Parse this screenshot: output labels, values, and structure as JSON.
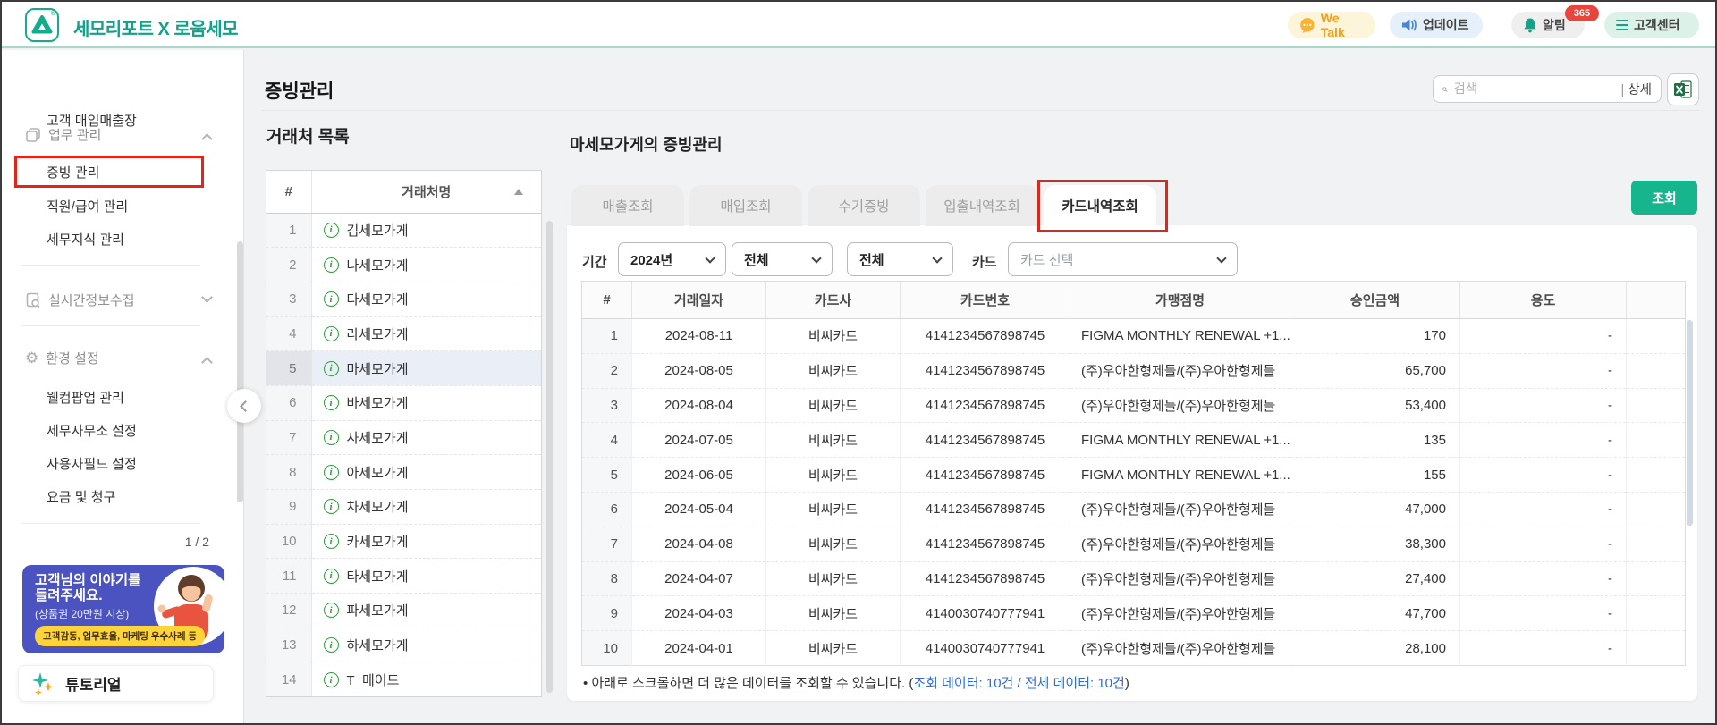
{
  "colors": {
    "accent_teal": "#12a188",
    "button_green": "#17b58e",
    "annotation_red": "#e0261b",
    "alarm_badge_red": "#e8453c",
    "link_blue": "#2f6be0",
    "banner_blue": "#4b53c0",
    "banner_yellow": "#ffd43a"
  },
  "header": {
    "brand": "세모리포트 X 로움세모",
    "we_talk": "We Talk",
    "update": "업데이트",
    "alarm": "알림",
    "alarm_badge": "365",
    "support": "고객센터"
  },
  "sidebar": {
    "customer_ledger": "고객 매입매출장",
    "work_section": "업무 관리",
    "work_items": [
      "증빙 관리",
      "직원/급여 관리",
      "세무지식 관리"
    ],
    "realtime_section": "실시간정보수집",
    "settings_section": "환경 설정",
    "settings_items": [
      "웰컴팝업 관리",
      "세무사무소 설정",
      "사용자필드 설정",
      "요금 및 청구"
    ],
    "banner_pager": "1 / 2",
    "banner": {
      "line1": "고객님의 이야기를",
      "line2": "들려주세요.",
      "line3": "(상품권 20만원 시상)",
      "tag": "고객감동, 업무효율, 마케팅 우수사례 등"
    },
    "tutorial": "튜토리얼"
  },
  "main": {
    "page_title": "증빙관리",
    "search": {
      "placeholder": "검색",
      "detail_label": "상세"
    },
    "client_list": {
      "title": "거래처 목록",
      "col_no": "#",
      "col_name": "거래처명",
      "selected_index": 4,
      "clients": [
        "김세모가게",
        "나세모가게",
        "다세모가게",
        "라세모가게",
        "마세모가게",
        "바세모가게",
        "사세모가게",
        "아세모가게",
        "차세모가게",
        "카세모가게",
        "타세모가게",
        "파세모가게",
        "하세모가게",
        "T_메이드"
      ]
    },
    "panel": {
      "title": "마세모가게의 증빙관리",
      "tabs": [
        "매출조회",
        "매입조회",
        "수기증빙",
        "입출내역조회",
        "카드내역조회"
      ],
      "active_tab": "카드내역조회",
      "search_button": "조회",
      "filters": {
        "period_label": "기간",
        "year": "2024년",
        "range_start": "전체",
        "range_end": "전체",
        "card_label": "카드",
        "card_placeholder": "카드 선택"
      },
      "table": {
        "columns": [
          "#",
          "거래일자",
          "카드사",
          "카드번호",
          "가맹점명",
          "승인금액",
          "용도"
        ],
        "rows": [
          [
            "1",
            "2024-08-11",
            "비씨카드",
            "4141234567898745",
            "FIGMA MONTHLY RENEWAL +1...",
            "170",
            "-"
          ],
          [
            "2",
            "2024-08-05",
            "비씨카드",
            "4141234567898745",
            "(주)우아한형제들/(주)우아한형제들",
            "65,700",
            "-"
          ],
          [
            "3",
            "2024-08-04",
            "비씨카드",
            "4141234567898745",
            "(주)우아한형제들/(주)우아한형제들",
            "53,400",
            "-"
          ],
          [
            "4",
            "2024-07-05",
            "비씨카드",
            "4141234567898745",
            "FIGMA MONTHLY RENEWAL +1...",
            "135",
            "-"
          ],
          [
            "5",
            "2024-06-05",
            "비씨카드",
            "4141234567898745",
            "FIGMA MONTHLY RENEWAL +1...",
            "155",
            "-"
          ],
          [
            "6",
            "2024-05-04",
            "비씨카드",
            "4141234567898745",
            "(주)우아한형제들/(주)우아한형제들",
            "47,000",
            "-"
          ],
          [
            "7",
            "2024-04-08",
            "비씨카드",
            "4141234567898745",
            "(주)우아한형제들/(주)우아한형제들",
            "38,300",
            "-"
          ],
          [
            "8",
            "2024-04-07",
            "비씨카드",
            "4141234567898745",
            "(주)우아한형제들/(주)우아한형제들",
            "27,400",
            "-"
          ],
          [
            "9",
            "2024-04-03",
            "비씨카드",
            "4140030740777941",
            "(주)우아한형제들/(주)우아한형제들",
            "47,700",
            "-"
          ],
          [
            "10",
            "2024-04-01",
            "비씨카드",
            "4140030740777941",
            "(주)우아한형제들/(주)우아한형제들",
            "28,100",
            "-"
          ]
        ]
      },
      "footnote_bullet": "•",
      "footnote_prefix": "아래로 스크롤하면 더 많은 데이터를 조회할 수 있습니다. (",
      "footnote_link": "조회 데이터: 10건 / 전체 데이터: 10건",
      "footnote_suffix": ")"
    }
  }
}
